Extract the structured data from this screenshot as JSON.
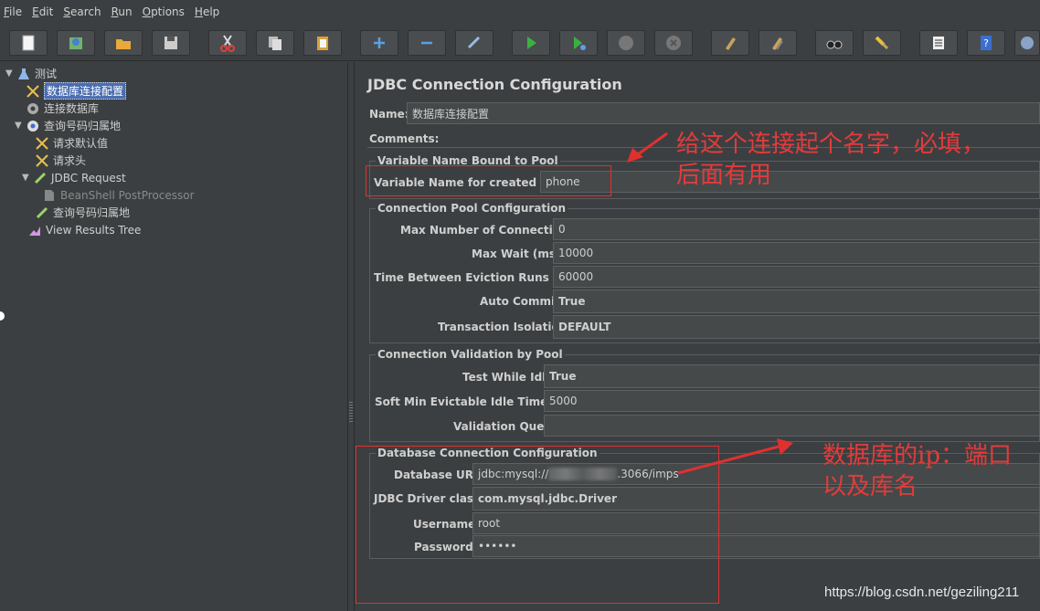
{
  "menu": [
    "File",
    "Edit",
    "Search",
    "Run",
    "Options",
    "Help"
  ],
  "toolbar": {
    "buttons": [
      "new-icon",
      "templates-icon",
      "open-icon",
      "save-icon",
      "cut-icon",
      "copy-icon",
      "paste-icon",
      "expand-icon",
      "collapse-icon",
      "toggle-icon",
      "start-icon",
      "start-no-pause-icon",
      "stop-icon",
      "shutdown-icon",
      "clear-icon",
      "clear-all-icon",
      "search-icon",
      "reset-search-icon",
      "function-helper-icon",
      "help-icon",
      "remote-icon"
    ]
  },
  "tree": {
    "items": [
      {
        "label": "测试",
        "icon": "test-plan-icon"
      },
      {
        "label": "数据库连接配置",
        "icon": "config-element-icon"
      },
      {
        "label": "连接数据库",
        "icon": "gear-icon"
      },
      {
        "label": "查询号码归属地",
        "icon": "thread-group-icon"
      },
      {
        "label": "请求默认值",
        "icon": "config-element-icon"
      },
      {
        "label": "请求头",
        "icon": "config-element-icon"
      },
      {
        "label": "JDBC Request",
        "icon": "sampler-icon"
      },
      {
        "label": "BeanShell PostProcessor",
        "icon": "postprocessor-icon"
      },
      {
        "label": "查询号码归属地",
        "icon": "sampler-icon"
      },
      {
        "label": "View Results Tree",
        "icon": "listener-icon"
      }
    ]
  },
  "panel": {
    "title": "JDBC Connection Configuration",
    "name_label": "Name:",
    "name_value": "数据库连接配置",
    "comments_label": "Comments:",
    "group1": {
      "title": "Variable Name Bound to Pool",
      "var_label": "Variable Name for created pool:",
      "var_value": "phone"
    },
    "group2": {
      "title": "Connection Pool Configuration",
      "max_conn_label": "Max Number of Connections:",
      "max_conn_value": "0",
      "max_wait_label": "Max Wait (ms):",
      "max_wait_value": "10000",
      "eviction_label": "Time Between Eviction Runs (ms):",
      "eviction_value": "60000",
      "auto_commit_label": "Auto Commit:",
      "auto_commit_value": "True",
      "isolation_label": "Transaction Isolation:",
      "isolation_value": "DEFAULT"
    },
    "group3": {
      "title": "Connection Validation by Pool",
      "test_idle_label": "Test While Idle:",
      "test_idle_value": "True",
      "soft_min_label": "Soft Min Evictable Idle Time(ms):",
      "soft_min_value": "5000",
      "validation_label": "Validation Query:",
      "validation_value": ""
    },
    "group4": {
      "title": "Database Connection Configuration",
      "url_label": "Database URL:",
      "url_prefix": "jdbc:mysql://",
      "url_suffix": ".3066/imps",
      "driver_label": "JDBC Driver class:",
      "driver_value": "com.mysql.jdbc.Driver",
      "user_label": "Username:",
      "user_value": "root",
      "pass_label": "Password:",
      "pass_value": "••••••"
    }
  },
  "annotations": {
    "note1_line1": "给这个连接起个名字，必填，",
    "note1_line2": "后面有用",
    "note2_line1": "数据库的ip：端口",
    "note2_line2": "以及库名",
    "color": "#e33b3b"
  },
  "watermark": "https://blog.csdn.net/geziling211"
}
